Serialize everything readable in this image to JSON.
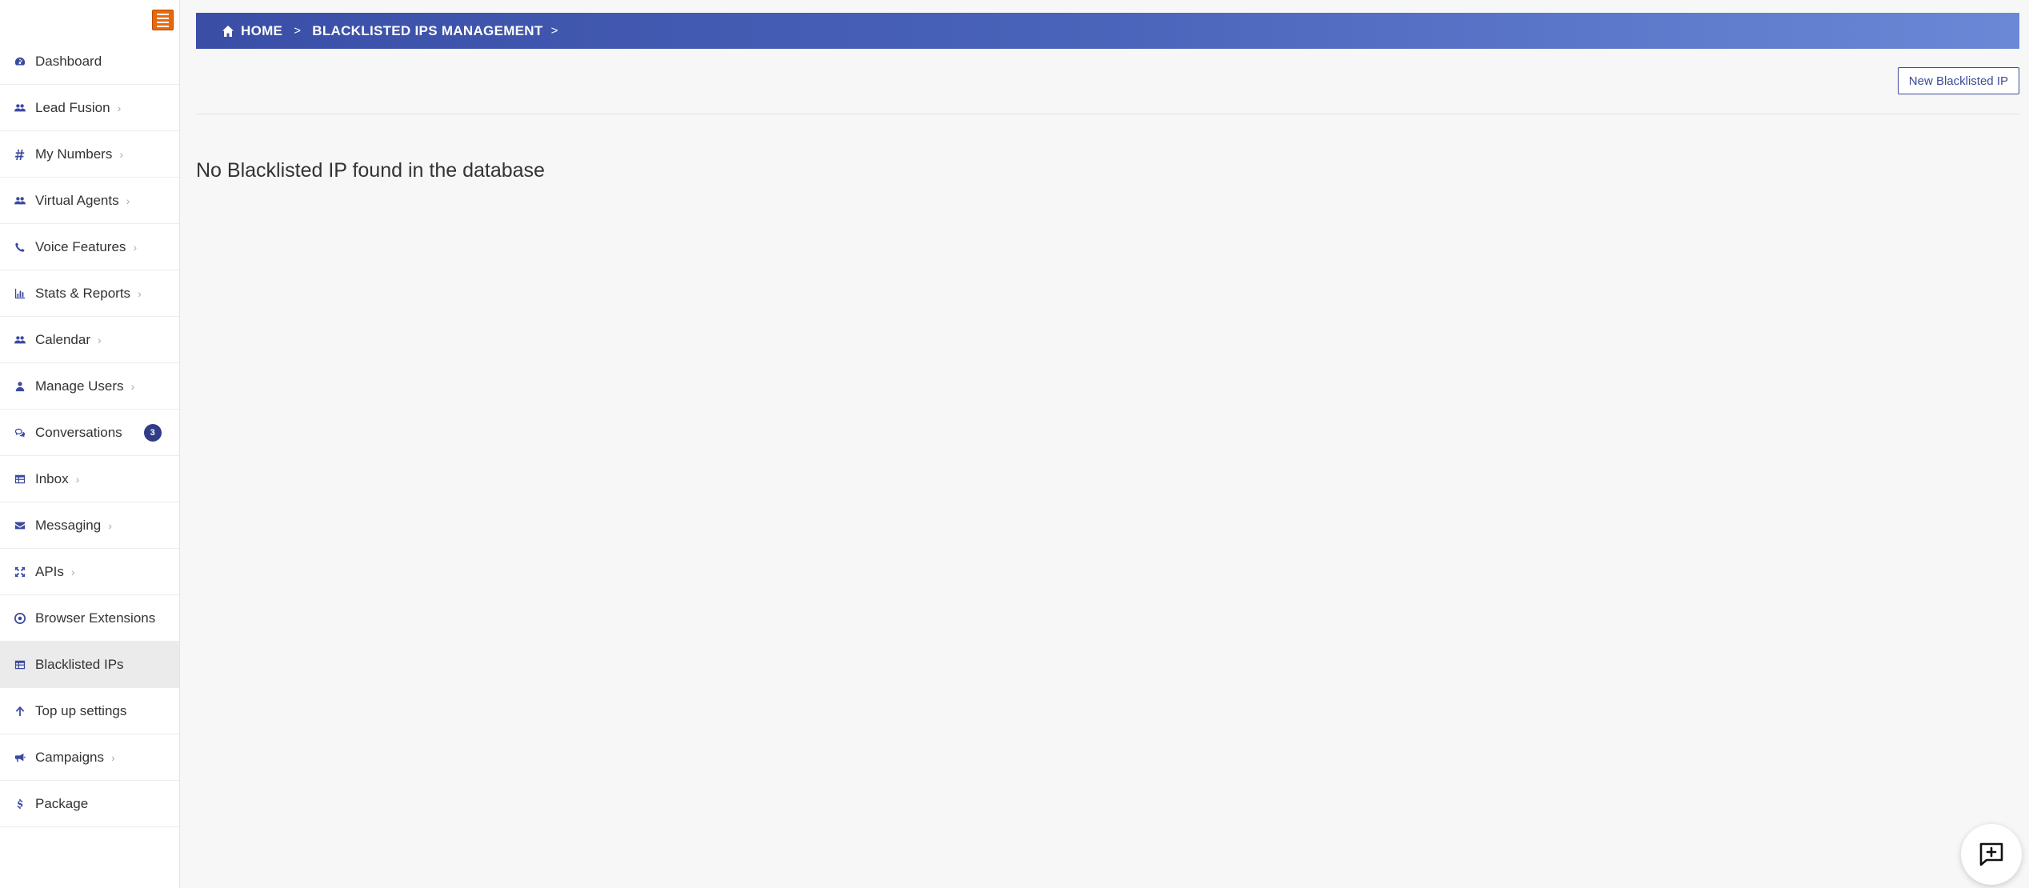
{
  "sidebar": {
    "items": [
      {
        "label": "Dashboard",
        "icon": "dashboard-icon",
        "chevron": false
      },
      {
        "label": "Lead Fusion",
        "icon": "users-icon",
        "chevron": true
      },
      {
        "label": "My Numbers",
        "icon": "hash-icon",
        "chevron": true
      },
      {
        "label": "Virtual Agents",
        "icon": "users-icon",
        "chevron": true
      },
      {
        "label": "Voice Features",
        "icon": "phone-icon",
        "chevron": true
      },
      {
        "label": "Stats & Reports",
        "icon": "bar-chart-icon",
        "chevron": true
      },
      {
        "label": "Calendar",
        "icon": "users-icon",
        "chevron": true
      },
      {
        "label": "Manage Users",
        "icon": "user-tie-icon",
        "chevron": true
      },
      {
        "label": "Conversations",
        "icon": "comments-icon",
        "chevron": false,
        "badge": "3"
      },
      {
        "label": "Inbox",
        "icon": "table-icon",
        "chevron": true
      },
      {
        "label": "Messaging",
        "icon": "envelope-icon",
        "chevron": true
      },
      {
        "label": "APIs",
        "icon": "arrows-icon",
        "chevron": true
      },
      {
        "label": "Browser Extensions",
        "icon": "chrome-icon",
        "chevron": false
      },
      {
        "label": "Blacklisted IPs",
        "icon": "table-icon",
        "chevron": false,
        "active": true
      },
      {
        "label": "Top up settings",
        "icon": "arrow-up-icon",
        "chevron": false
      },
      {
        "label": "Campaigns",
        "icon": "bullhorn-icon",
        "chevron": true
      },
      {
        "label": "Package",
        "icon": "dollar-icon",
        "chevron": false
      }
    ]
  },
  "breadcrumb": {
    "home": "HOME",
    "current": "BLACKLISTED IPS MANAGEMENT",
    "separator": ">"
  },
  "toolbar": {
    "new_button_label": "New Blacklisted IP"
  },
  "main": {
    "empty_message": "No Blacklisted IP found in the database"
  },
  "colors": {
    "accent": "#3b4aa0",
    "toggle": "#e8690c",
    "badge": "#313c87"
  }
}
